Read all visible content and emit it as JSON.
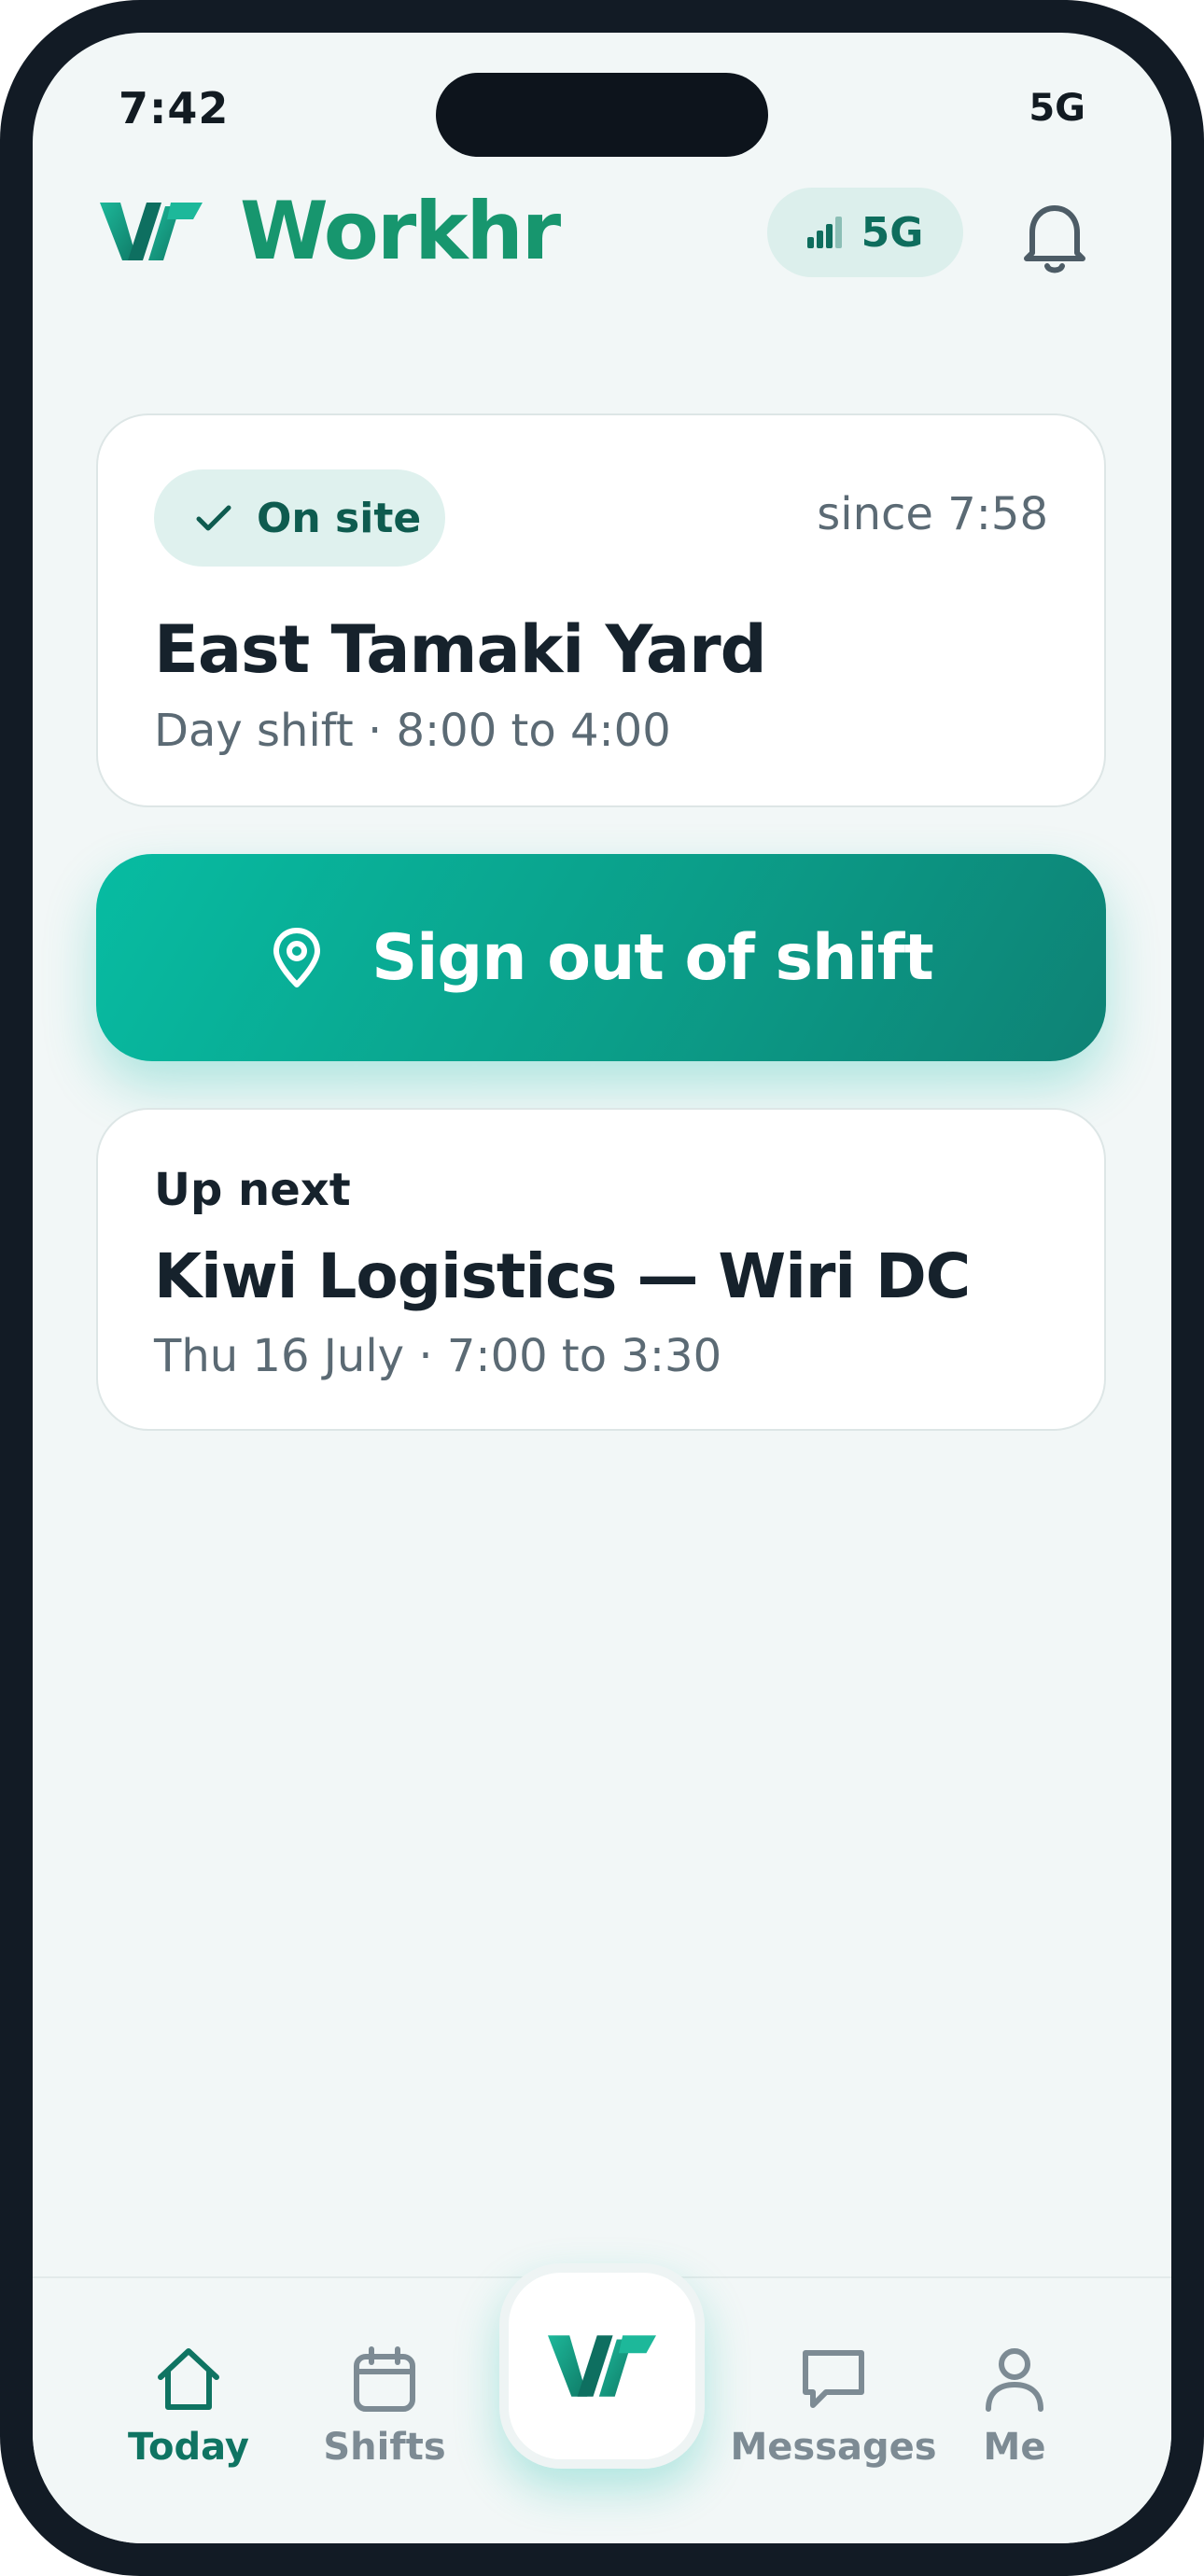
{
  "status_bar": {
    "time": "7:42",
    "network": "5G"
  },
  "header": {
    "app_name": "Workhr",
    "signal_label": "5G"
  },
  "current_shift": {
    "status": "On site",
    "since": "since 7:58",
    "site_name": "East Tamaki Yard",
    "details": "Day shift · 8:00 to 4:00"
  },
  "sign_out_button": {
    "label": "Sign out of shift"
  },
  "up_next": {
    "heading": "Up next",
    "name": "Kiwi Logistics — Wiri DC",
    "details": "Thu 16 July · 7:00 to 3:30"
  },
  "nav": {
    "items": [
      {
        "label": "Today",
        "icon": "home-icon",
        "active": true
      },
      {
        "label": "Shifts",
        "icon": "calendar-icon",
        "active": false
      },
      {
        "label": "Messages",
        "icon": "chat-icon",
        "active": false
      },
      {
        "label": "Me",
        "icon": "person-icon",
        "active": false
      }
    ],
    "center_button_icon": "workhr-logo-icon"
  },
  "colors": {
    "brand": "#17966e",
    "accent": "#07bca2",
    "accent_dark": "#0e8275",
    "background": "#f2f7f7",
    "muted_text": "#5b6a74"
  }
}
